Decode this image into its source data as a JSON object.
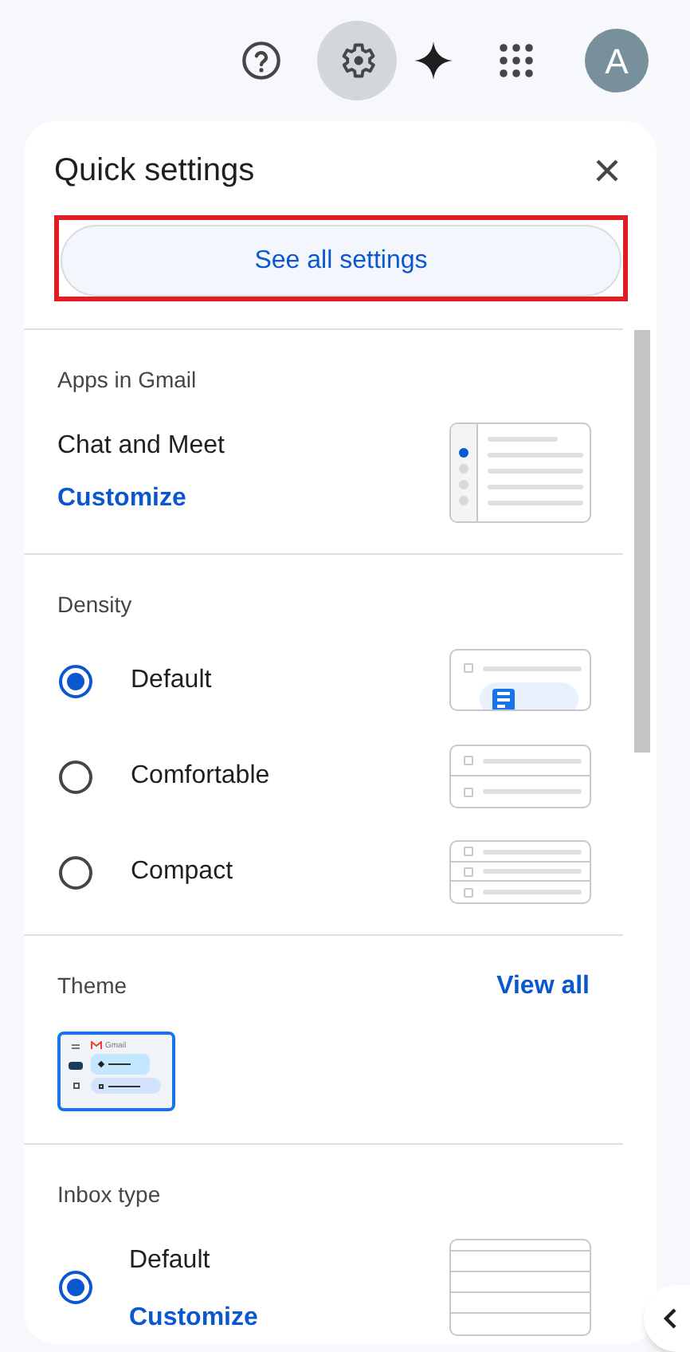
{
  "header": {
    "avatar_letter": "A"
  },
  "panel": {
    "title": "Quick settings",
    "see_all": {
      "label": "See all settings",
      "highlighted": true
    }
  },
  "apps": {
    "heading": "Apps in Gmail",
    "name": "Chat and Meet",
    "link": "Customize"
  },
  "density": {
    "heading": "Density",
    "options": [
      {
        "label": "Default",
        "selected": true
      },
      {
        "label": "Comfortable",
        "selected": false
      },
      {
        "label": "Compact",
        "selected": false
      }
    ]
  },
  "theme": {
    "heading": "Theme",
    "link": "View all",
    "thumbnail_label": "Gmail"
  },
  "inbox_type": {
    "heading": "Inbox type",
    "options": [
      {
        "label": "Default",
        "selected": true,
        "link": "Customize"
      }
    ]
  }
}
